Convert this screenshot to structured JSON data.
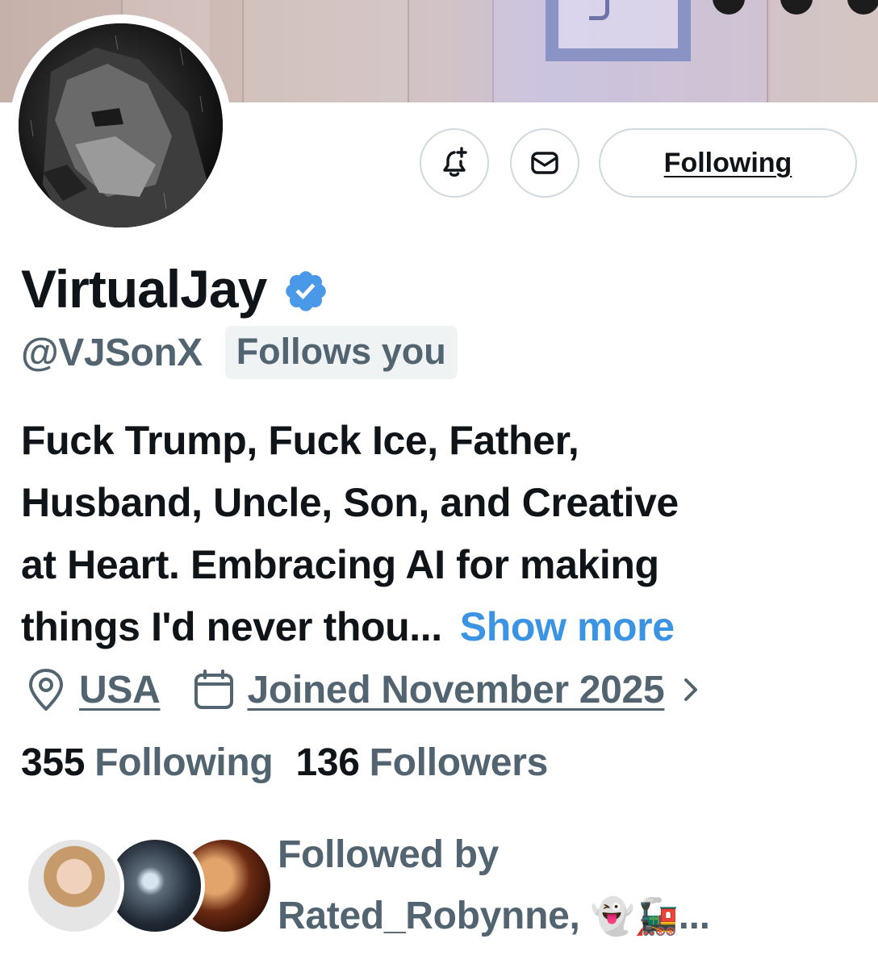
{
  "header": {
    "banner_icon": "banner-image",
    "avatar_icon": "profile-avatar-dog"
  },
  "actions": {
    "notify_icon": "bell-plus-icon",
    "message_icon": "envelope-icon",
    "follow_button_label": "Following"
  },
  "profile": {
    "display_name": "VirtualJay",
    "verified_icon": "verified-badge-icon",
    "handle": "@VJSonX",
    "follows_you_label": "Follows you",
    "bio_lines": [
      "Fuck Trump, Fuck Ice, Father,",
      "Husband, Uncle, Son, and Creative",
      "at Heart. Embracing AI for making",
      "things I'd never thou..."
    ],
    "show_more_label": "Show more",
    "location": "USA",
    "location_icon": "location-pin-icon",
    "joined": "Joined November 2025",
    "joined_icon": "calendar-icon",
    "joined_chevron_icon": "chevron-right-icon",
    "following_count": "355",
    "following_label": "Following",
    "followers_count": "136",
    "followers_label": "Followers"
  },
  "followed_by": {
    "line1": "Followed by",
    "line2_name": "Rated_Robynne,",
    "line2_emoji": "👻🚂",
    "line2_ellipsis": "...",
    "faces": [
      "follower-avatar-1",
      "follower-avatar-2",
      "follower-avatar-3"
    ]
  },
  "colors": {
    "text_primary": "#0f1419",
    "text_secondary": "#536471",
    "accent_link": "#3b93e3",
    "verified_blue": "#4a99e9",
    "border": "#cfd9de"
  }
}
